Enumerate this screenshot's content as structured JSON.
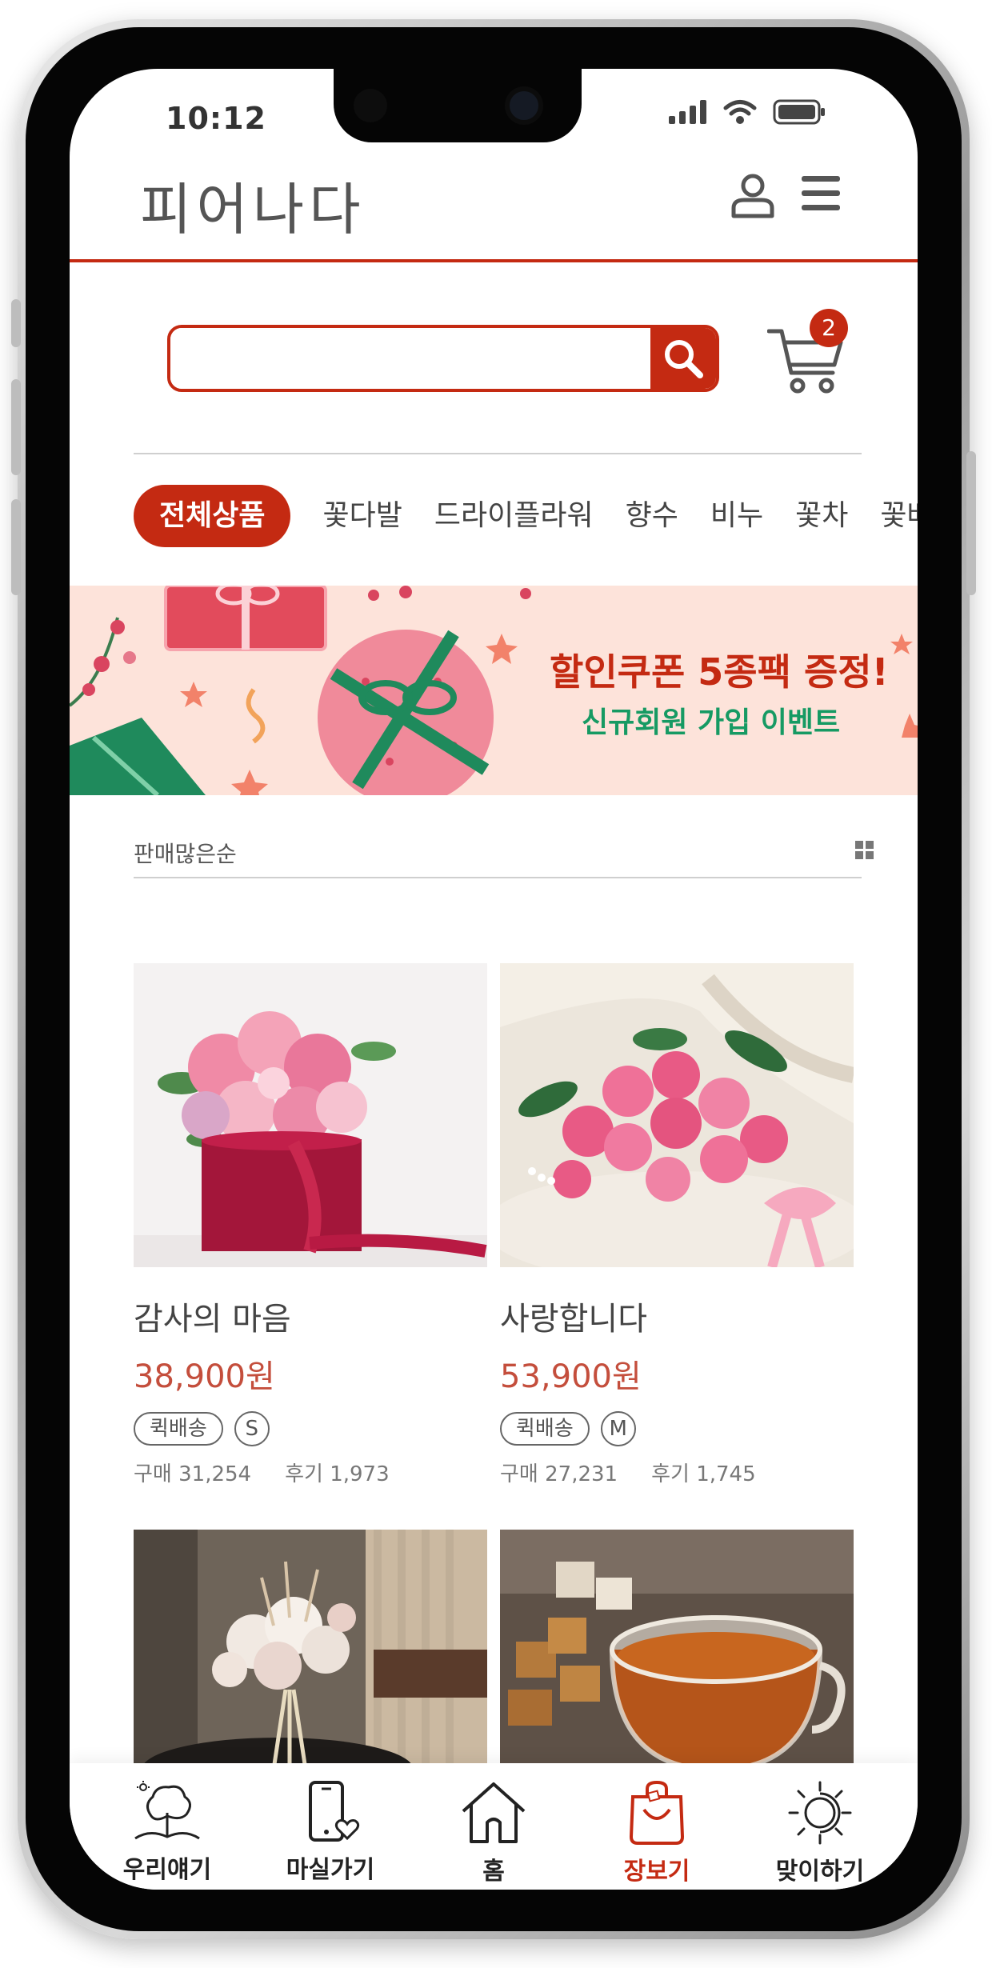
{
  "status_bar": {
    "time": "10:12"
  },
  "header": {
    "logo": "피어나다"
  },
  "search": {
    "placeholder": "",
    "cart_count": "2"
  },
  "categories": [
    "전체상품",
    "꽃다발",
    "드라이플라워",
    "향수",
    "비누",
    "꽃차",
    "꽃배달"
  ],
  "banner": {
    "title": "할인쿠폰 5종팩 증정!",
    "subtitle": "신규회원 가입 이벤트"
  },
  "sort": {
    "label": "판매많은순"
  },
  "products": [
    {
      "name": "감사의 마음",
      "price": "38,900원",
      "tag": "퀵배송",
      "size": "S",
      "purchase": "구매 31,254",
      "review": "후기 1,973"
    },
    {
      "name": "사랑합니다",
      "price": "53,900원",
      "tag": "퀵배송",
      "size": "M",
      "purchase": "구매 27,231",
      "review": "후기 1,745"
    }
  ],
  "bottom_nav": [
    {
      "label": "우리얘기",
      "icon": "tree-icon"
    },
    {
      "label": "마실가기",
      "icon": "phone-heart-icon"
    },
    {
      "label": "홈",
      "icon": "home-icon"
    },
    {
      "label": "장보기",
      "icon": "shopping-bag-icon",
      "active": true
    },
    {
      "label": "맞이하기",
      "icon": "sun-icon"
    }
  ],
  "colors": {
    "accent": "#c42a12",
    "price": "#c44e3c",
    "event_green": "#169a63",
    "banner_bg": "#fde3da"
  }
}
